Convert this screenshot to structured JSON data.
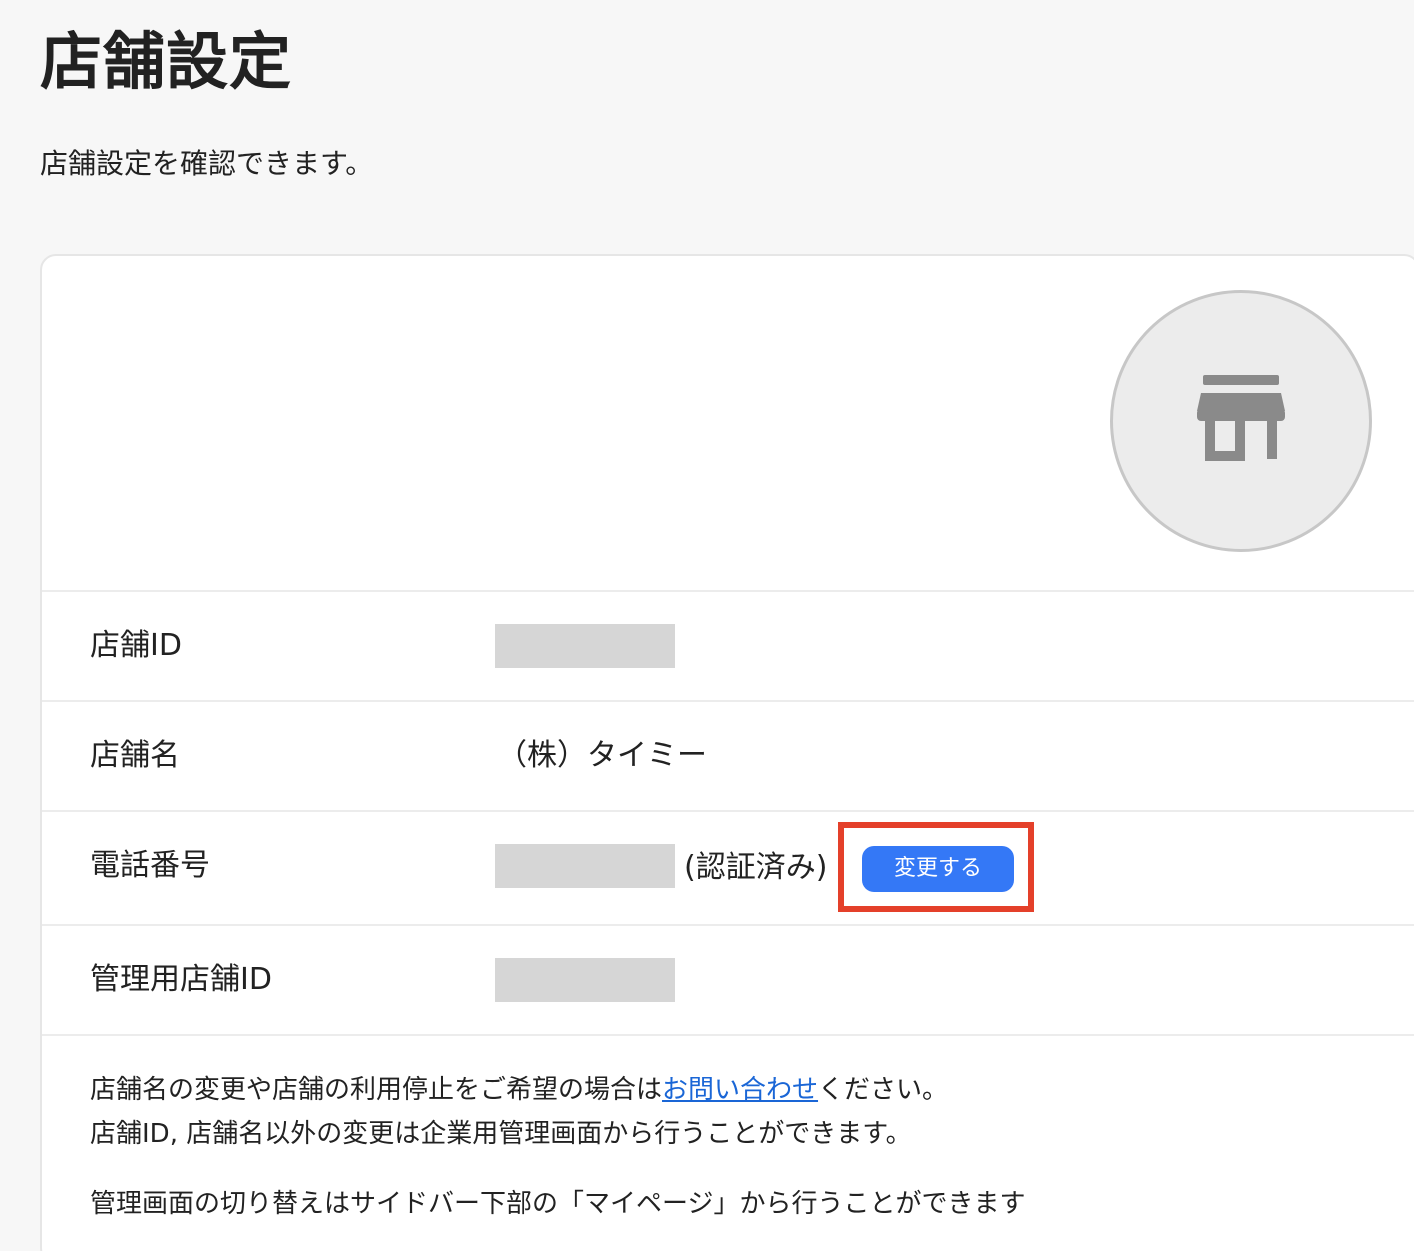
{
  "header": {
    "title": "店舗設定",
    "subtitle": "店舗設定を確認できます。"
  },
  "store_card": {
    "avatar_icon": "store-icon",
    "rows": [
      {
        "label": "店舗ID",
        "value": ""
      },
      {
        "label": "店舗名",
        "value": "（株）タイミー"
      },
      {
        "label": "電話番号",
        "value": "",
        "status": "(認証済み)",
        "button_label": "変更する"
      },
      {
        "label": "管理用店舗ID",
        "value": ""
      }
    ],
    "notes": {
      "line1_before": "店舗名の変更や店舗の利用停止をご希望の場合は",
      "line1_link": "お問い合わせ",
      "line1_after": "ください。",
      "line2": "店舗ID, 店舗名以外の変更は企業用管理画面から行うことができます。",
      "line3": "管理画面の切り替えはサイドバー下部の「マイページ」から行うことができます"
    }
  },
  "colors": {
    "accent_button": "#3478f6",
    "highlight_border": "#e4402a",
    "link": "#1a66d6",
    "redacted": "#d6d6d6"
  }
}
